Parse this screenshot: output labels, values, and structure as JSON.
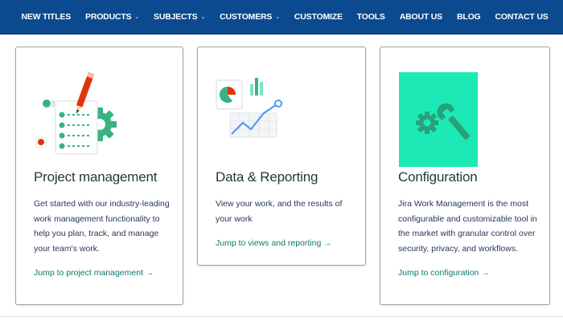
{
  "nav": {
    "items": [
      {
        "label": "NEW TITLES",
        "has_dropdown": false
      },
      {
        "label": "PRODUCTS",
        "has_dropdown": true
      },
      {
        "label": "SUBJECTS",
        "has_dropdown": true
      },
      {
        "label": "CUSTOMERS",
        "has_dropdown": true
      },
      {
        "label": "CUSTOMIZE",
        "has_dropdown": false
      },
      {
        "label": "TOOLS",
        "has_dropdown": false
      },
      {
        "label": "ABOUT US",
        "has_dropdown": false
      },
      {
        "label": "BLOG",
        "has_dropdown": false
      },
      {
        "label": "CONTACT US",
        "has_dropdown": false
      }
    ],
    "caret_glyph": "⌄"
  },
  "cards": [
    {
      "title": "Project management",
      "description": "Get started with our industry-leading work management functionality to help you plan, track, and manage your team's work.",
      "link": "Jump to project management",
      "icon": "checklist-gear-icon"
    },
    {
      "title": "Data & Reporting",
      "description": "View your work, and the results of your work",
      "link": "Jump to views and reporting",
      "icon": "chart-report-icon"
    },
    {
      "title": "Configuration",
      "description": "Jira Work Management is the most configurable and customizable tool in the market with granular control over security, privacy, and workflows.",
      "link": "Jump to configuration",
      "icon": "gear-wrench-icon"
    }
  ],
  "link_arrow": "→",
  "colors": {
    "nav_bg": "#0c4a8f",
    "accent_green": "#36b37e",
    "link_teal": "#0b7a6d",
    "config_tile": "#1de9b6",
    "chart_red": "#de350b",
    "title_text": "#1d3a33"
  }
}
